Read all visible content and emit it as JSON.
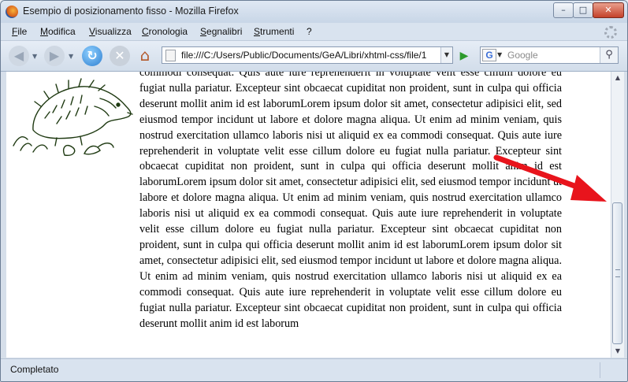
{
  "window": {
    "title": "Esempio di posizionamento fisso - Mozilla Firefox",
    "controls": {
      "minimize": "–",
      "maximize": "□",
      "close": "✕"
    }
  },
  "menu": [
    "File",
    "Modifica",
    "Visualizza",
    "Cronologia",
    "Segnalibri",
    "Strumenti",
    "?"
  ],
  "navigation": {
    "url": "file:///C:/Users/Public/Documents/GeA/Libri/xhtml-css/file/1",
    "search_placeholder": "Google",
    "search_engine_letter": "G",
    "icons": {
      "back": "◀",
      "forward": "▶",
      "dropdown": "▼",
      "reload": "↻",
      "stop": "✕",
      "home": "⌂",
      "go": "▶",
      "search": "⚲"
    }
  },
  "page": {
    "body_text": "commodi consequat. Quis aute iure reprehenderit in voluptate velit esse cillum dolore eu fugiat nulla pariatur. Excepteur sint obcaecat cupiditat non proident, sunt in culpa qui officia deserunt mollit anim id est laborumLorem ipsum dolor sit amet, consectetur adipisici elit, sed eiusmod tempor incidunt ut labore et dolore magna aliqua. Ut enim ad minim veniam, quis nostrud exercitation ullamco laboris nisi ut aliquid ex ea commodi consequat. Quis aute iure reprehenderit in voluptate velit esse cillum dolore eu fugiat nulla pariatur. Excepteur sint obcaecat cupiditat non proident, sunt in culpa qui officia deserunt mollit anim id est laborumLorem ipsum dolor sit amet, consectetur adipisici elit, sed eiusmod tempor incidunt ut labore et dolore magna aliqua. Ut enim ad minim veniam, quis nostrud exercitation ullamco laboris nisi ut aliquid ex ea commodi consequat. Quis aute iure reprehenderit in voluptate velit esse cillum dolore eu fugiat nulla pariatur. Excepteur sint obcaecat cupiditat non proident, sunt in culpa qui officia deserunt mollit anim id est laborumLorem ipsum dolor sit amet, consectetur adipisici elit, sed eiusmod tempor incidunt ut labore et dolore magna aliqua. Ut enim ad minim veniam, quis nostrud exercitation ullamco laboris nisi ut aliquid ex ea commodi consequat. Quis aute iure reprehenderit in voluptate velit esse cillum dolore eu fugiat nulla pariatur. Excepteur sint obcaecat cupiditat non proident, sunt in culpa qui officia deserunt mollit anim id est laborum",
    "image": "hedgehog-drawing"
  },
  "scrollbar": {
    "up": "▲",
    "down": "▼"
  },
  "status": {
    "text": "Completato"
  },
  "colors": {
    "annotation_arrow": "#e8141c",
    "window_frame": "#6b7d95"
  }
}
